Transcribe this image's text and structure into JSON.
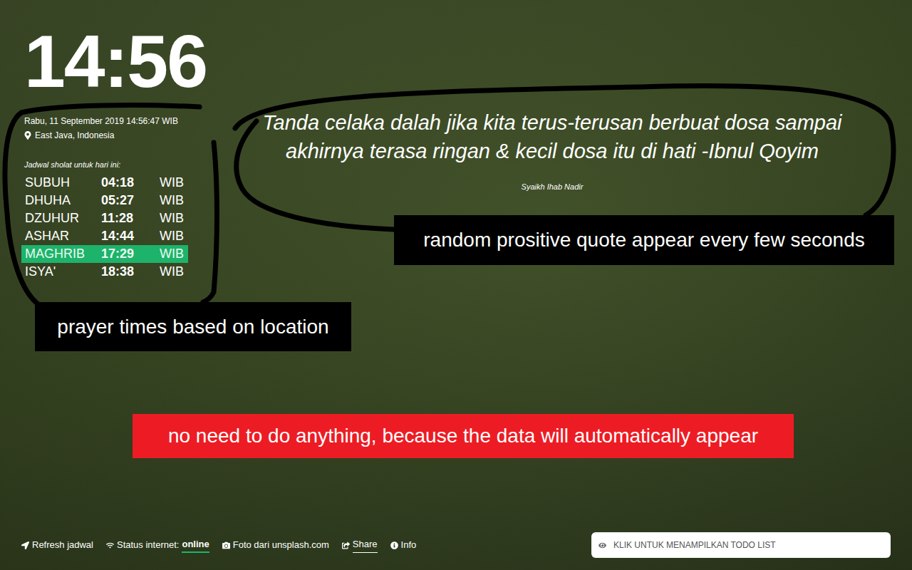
{
  "clock": {
    "time": "14:56",
    "date": "Rabu, 11 September 2019 14:56:47 WIB",
    "location": "East Java, Indonesia"
  },
  "prayer": {
    "heading": "Jadwal sholat untuk hari ini:",
    "times": [
      {
        "name": "SUBUH",
        "time": "04:18",
        "zone": "WIB",
        "selected": false
      },
      {
        "name": "DHUHA",
        "time": "05:27",
        "zone": "WIB",
        "selected": false
      },
      {
        "name": "DZUHUR",
        "time": "11:28",
        "zone": "WIB",
        "selected": false
      },
      {
        "name": "ASHAR",
        "time": "14:44",
        "zone": "WIB",
        "selected": false
      },
      {
        "name": "MAGHRIB",
        "time": "17:29",
        "zone": "WIB",
        "selected": true
      },
      {
        "name": "ISYA'",
        "time": "18:38",
        "zone": "WIB",
        "selected": false
      }
    ]
  },
  "quote": {
    "text": "Tanda celaka dalah jika kita terus-terusan berbuat dosa sampai akhirnya terasa ringan & kecil dosa itu di hati -Ibnul Qoyim",
    "author": "Syaikh Ihab Nadir"
  },
  "annotations": [
    {
      "text": "random prositive quote appear every few seconds",
      "color": "#000000"
    },
    {
      "text": "prayer times based on location",
      "color": "#000000"
    },
    {
      "text": "no need to do anything, because the data will automatically appear",
      "color": "#ed1c24"
    }
  ],
  "footer": {
    "items": [
      {
        "label": "Refresh jadwal",
        "value": "",
        "underlined": false
      },
      {
        "label": "Status internet:",
        "value": "online",
        "underlined": false
      },
      {
        "label": "Foto dari unsplash.com",
        "value": "",
        "underlined": false
      },
      {
        "label": "Share",
        "value": "",
        "underlined": true
      },
      {
        "label": "Info",
        "value": "",
        "underlined": false
      }
    ]
  },
  "todo": {
    "label": "KLIK UNTUK MENAMPILKAN TODO LIST"
  }
}
